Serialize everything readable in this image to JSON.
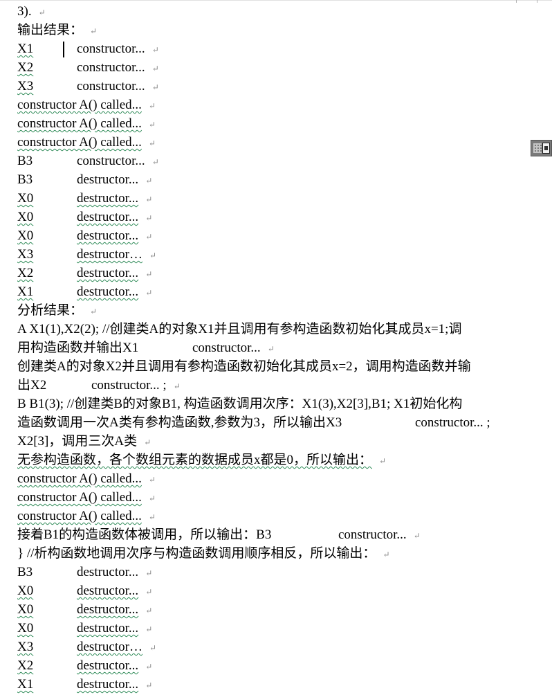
{
  "paragraph_mark": "↵",
  "fragments": {
    "line_top": "3).",
    "output_heading": "输出结果：",
    "analysis_heading": "分析结果："
  },
  "output_lines": [
    {
      "id": "X1",
      "text": "constructor..."
    },
    {
      "id": "X2",
      "text": "constructor..."
    },
    {
      "id": "X3",
      "text": "constructor..."
    },
    {
      "full": "constructor A() called..."
    },
    {
      "full": "constructor A() called..."
    },
    {
      "full": "constructor A() called..."
    },
    {
      "id": "B3",
      "text": "constructor..."
    },
    {
      "id": "B3",
      "text": "destructor..."
    },
    {
      "id": "X0",
      "text": "destructor..."
    },
    {
      "id": "X0",
      "text": "destructor..."
    },
    {
      "id": "X0",
      "text": "destructor..."
    },
    {
      "id": "X3",
      "text": "destructor…"
    },
    {
      "id": "X2",
      "text": "destructor..."
    },
    {
      "id": "X1",
      "text": "destructor..."
    }
  ],
  "analysis": {
    "p1_line1": "A X1(1),X2(2); //创建类A的对象X1并且调用有参构造函数初始化其成员x=1;调",
    "p1_line2_a": "用构造函数并输出X1",
    "p1_line2_b": "constructor...",
    "p2_line1": "创建类A的对象X2并且调用有参构造函数初始化其成员x=2，调用构造函数并输",
    "p2_line2_a": "出X2",
    "p2_line2_b": "constructor... ;",
    "p3_line1": "B B1(3); //创建类B的对象B1, 构造函数调用次序：X1(3),X2[3],B1; X1初始化构",
    "p3_line2_a": "造函数调用一次A类有参构造函数,参数为3，所以输出X3",
    "p3_line2_b": "constructor... ;",
    "p3_line3": "X2[3]，调用三次A类",
    "p4_line1": "无参构造函数，各个数组元素的数据成员x都是0，所以输出：",
    "called_lines": [
      "constructor A() called...",
      "constructor A() called...",
      "constructor A() called..."
    ],
    "p5_line1_a": "接着B1的构造函数体被调用，所以输出：B3",
    "p5_line1_b": "constructor...",
    "p6_line1": "} //析构函数地调用次序与构造函数调用顺序相反，所以输出："
  },
  "final_lines": [
    {
      "id": "B3",
      "text": "destructor..."
    },
    {
      "id": "X0",
      "text": "destructor..."
    },
    {
      "id": "X0",
      "text": "destructor..."
    },
    {
      "id": "X0",
      "text": "destructor..."
    },
    {
      "id": "X3",
      "text": "destructor…"
    },
    {
      "id": "X2",
      "text": "destructor..."
    },
    {
      "id": "X1",
      "text": "destructor..."
    }
  ]
}
